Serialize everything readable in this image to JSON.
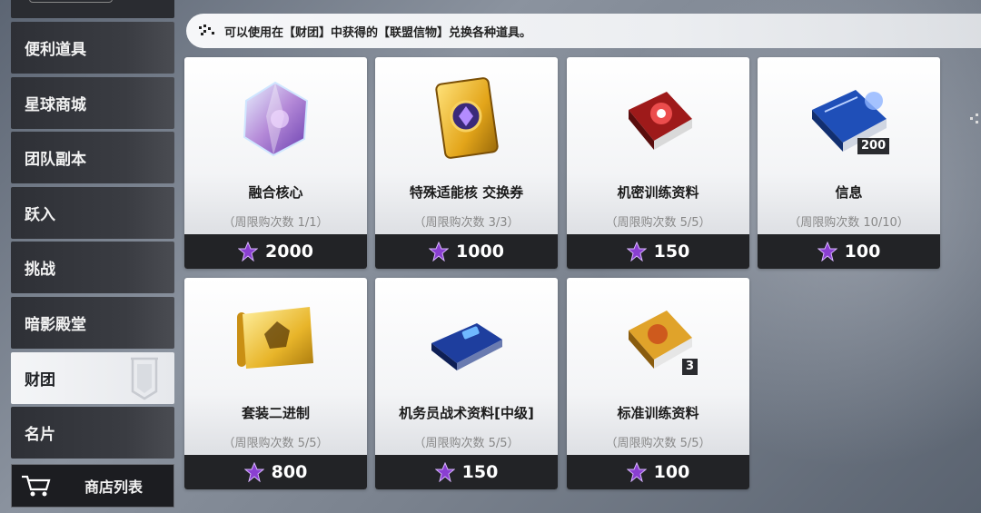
{
  "sidebar": {
    "items": [
      {
        "label": "便利道具"
      },
      {
        "label": "星球商城"
      },
      {
        "label": "团队副本"
      },
      {
        "label": "跃入"
      },
      {
        "label": "挑战"
      },
      {
        "label": "暗影殿堂"
      },
      {
        "label": "财团",
        "active": true
      },
      {
        "label": "名片"
      }
    ],
    "shop_list_label": "商店列表"
  },
  "notice": {
    "text": "可以使用在【财团】中获得的【联盟信物】兑换各种道具。"
  },
  "currency_icon": "alliance-token-icon",
  "items": [
    {
      "name": "融合核心",
      "limit": "（周限购次数 1/1）",
      "price": "2000",
      "icon": "fusion-core-crystal",
      "badge": ""
    },
    {
      "name": "特殊适能核 交换券",
      "limit": "（周限购次数 3/3）",
      "price": "1000",
      "icon": "special-core-ticket",
      "badge": ""
    },
    {
      "name": "机密训练资料",
      "limit": "（周限购次数 5/5）",
      "price": "150",
      "icon": "classified-training-book",
      "badge": ""
    },
    {
      "name": "信息",
      "limit": "（周限购次数 10/10）",
      "price": "100",
      "icon": "information-book",
      "badge": "200"
    },
    {
      "name": "套装二进制",
      "limit": "（周限购次数 5/5）",
      "price": "800",
      "icon": "binary-scroll",
      "badge": ""
    },
    {
      "name": "机务员战术资料[中级]",
      "limit": "（周限购次数 5/5）",
      "price": "150",
      "icon": "xp-chip",
      "badge": ""
    },
    {
      "name": "标准训练资料",
      "limit": "（周限购次数 5/5）",
      "price": "100",
      "icon": "standard-training-book",
      "badge": "3"
    }
  ],
  "colors": {
    "token_purple": "#8a3fd1",
    "price_bar": "#222326",
    "active_tab": "#f0f1f4"
  }
}
